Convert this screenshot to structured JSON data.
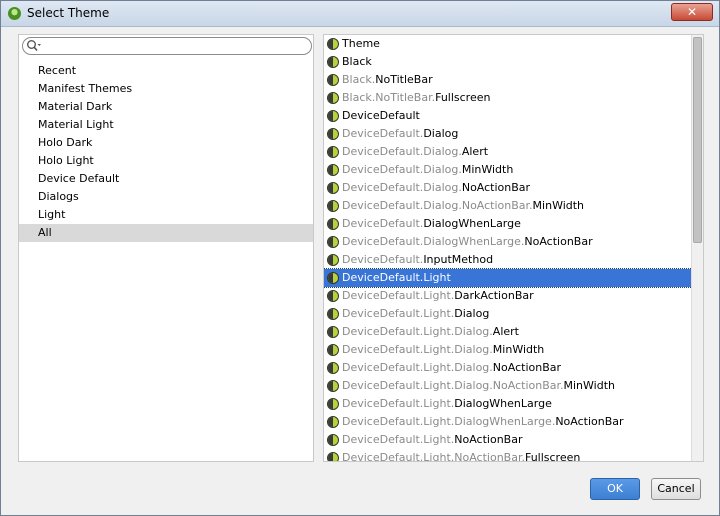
{
  "window": {
    "title": "Select Theme",
    "close_label": "✕"
  },
  "search": {
    "placeholder": "",
    "value": ""
  },
  "categories": [
    {
      "label": "Recent"
    },
    {
      "label": "Manifest Themes"
    },
    {
      "label": "Material Dark"
    },
    {
      "label": "Material Light"
    },
    {
      "label": "Holo Dark"
    },
    {
      "label": "Holo Light"
    },
    {
      "label": "Device Default"
    },
    {
      "label": "Dialogs"
    },
    {
      "label": "Light"
    },
    {
      "label": "All",
      "selected": true
    }
  ],
  "themes": [
    {
      "prefix": "",
      "name": "Theme"
    },
    {
      "prefix": "",
      "name": "Black"
    },
    {
      "prefix": "Black.",
      "name": "NoTitleBar"
    },
    {
      "prefix": "Black.NoTitleBar.",
      "name": "Fullscreen"
    },
    {
      "prefix": "",
      "name": "DeviceDefault"
    },
    {
      "prefix": "DeviceDefault.",
      "name": "Dialog"
    },
    {
      "prefix": "DeviceDefault.Dialog.",
      "name": "Alert"
    },
    {
      "prefix": "DeviceDefault.Dialog.",
      "name": "MinWidth"
    },
    {
      "prefix": "DeviceDefault.Dialog.",
      "name": "NoActionBar"
    },
    {
      "prefix": "DeviceDefault.Dialog.NoActionBar.",
      "name": "MinWidth"
    },
    {
      "prefix": "DeviceDefault.",
      "name": "DialogWhenLarge"
    },
    {
      "prefix": "DeviceDefault.DialogWhenLarge.",
      "name": "NoActionBar"
    },
    {
      "prefix": "DeviceDefault.",
      "name": "InputMethod"
    },
    {
      "prefix": "DeviceDefault.",
      "name": "Light",
      "selected": true
    },
    {
      "prefix": "DeviceDefault.Light.",
      "name": "DarkActionBar"
    },
    {
      "prefix": "DeviceDefault.Light.",
      "name": "Dialog"
    },
    {
      "prefix": "DeviceDefault.Light.Dialog.",
      "name": "Alert"
    },
    {
      "prefix": "DeviceDefault.Light.Dialog.",
      "name": "MinWidth"
    },
    {
      "prefix": "DeviceDefault.Light.Dialog.",
      "name": "NoActionBar"
    },
    {
      "prefix": "DeviceDefault.Light.Dialog.NoActionBar.",
      "name": "MinWidth"
    },
    {
      "prefix": "DeviceDefault.Light.",
      "name": "DialogWhenLarge"
    },
    {
      "prefix": "DeviceDefault.Light.DialogWhenLarge.",
      "name": "NoActionBar"
    },
    {
      "prefix": "DeviceDefault.Light.",
      "name": "NoActionBar"
    },
    {
      "prefix": "DeviceDefault.Light.NoActionBar.",
      "name": "Fullscreen"
    }
  ],
  "buttons": {
    "ok_label": "OK",
    "cancel_label": "Cancel"
  },
  "colors": {
    "selection": "#3875d7",
    "ok_button": "#3d7fd3",
    "theme_icon": "#b6d23d"
  },
  "icons": {
    "app": "android-studio-icon",
    "search": "search-icon",
    "theme": "theme-icon"
  }
}
